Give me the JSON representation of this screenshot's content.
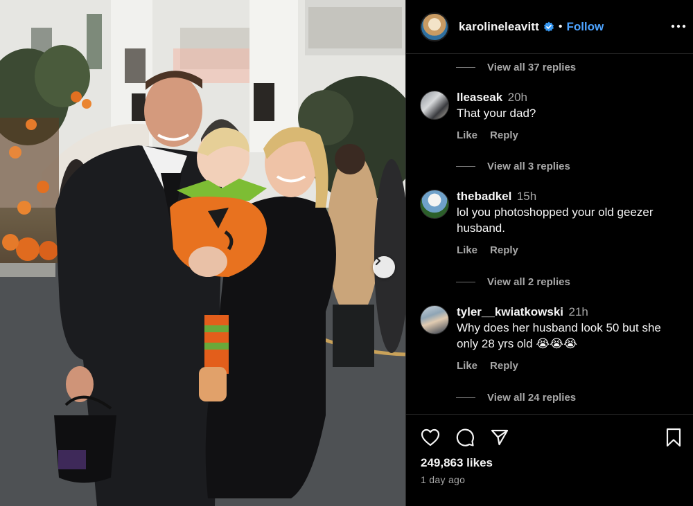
{
  "post": {
    "author": "karolineleavitt",
    "follow_label": "Follow",
    "separator": "•"
  },
  "comments": {
    "top_view_replies": "View all 37 replies",
    "items": [
      {
        "user": "lleaseak",
        "time": "20h",
        "text": "That your dad?",
        "like_label": "Like",
        "reply_label": "Reply",
        "view_replies": "View all 3 replies"
      },
      {
        "user": "thebadkel",
        "time": "15h",
        "text": "lol you photoshopped your old geezer husband.",
        "like_label": "Like",
        "reply_label": "Reply",
        "view_replies": "View all 2 replies"
      },
      {
        "user": "tyler__kwiatkowski",
        "time": "21h",
        "text": "Why does her husband look 50 but she only 28 yrs old 😭😭😭",
        "like_label": "Like",
        "reply_label": "Reply",
        "view_replies": "View all 24 replies"
      }
    ]
  },
  "footer": {
    "likes": "249,863 likes",
    "posted": "1 day ago"
  },
  "icons": {
    "like": "heart-icon",
    "comment": "speech-bubble-icon",
    "share": "paper-plane-icon",
    "save": "bookmark-icon",
    "more": "more-dots-icon",
    "next": "chevron-right-icon",
    "verified": "verified-badge-icon"
  },
  "colors": {
    "accent": "#4da3ff",
    "verified": "#3797f0",
    "background": "#000000",
    "muted_text": "#a8a8a8"
  }
}
